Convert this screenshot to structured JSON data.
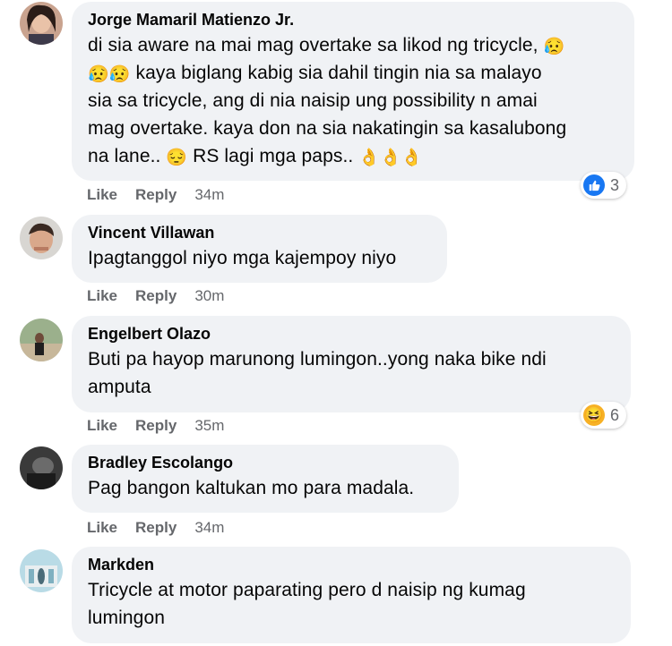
{
  "comments": [
    {
      "author": "Jorge Mamaril Matienzo Jr.",
      "lines": [
        "di sia aware na mai mag overtake sa likod ng tricycle, ",
        " kaya biglang kabig sia dahil tingin nia sa malayo",
        "sia sa tricycle, ang di nia naisip ung possibility n amai",
        "mag overtake. kaya don na sia nakatingin sa kasalubong",
        "na lane.. ",
        " RS lagi mga paps.. "
      ],
      "emoji_crying": "😥",
      "emoji_pensive": "😔",
      "emoji_ok": "👌",
      "like": "Like",
      "reply": "Reply",
      "time": "34m",
      "reaction_count": "3",
      "reaction_icon": "like-icon"
    },
    {
      "author": "Vincent Villawan",
      "text": "Ipagtanggol niyo mga kajempoy niyo",
      "like": "Like",
      "reply": "Reply",
      "time": "30m"
    },
    {
      "author": "Engelbert Olazo",
      "lines": [
        "Buti pa hayop marunong lumingon..yong naka bike ndi",
        "amputa"
      ],
      "like": "Like",
      "reply": "Reply",
      "time": "35m",
      "reaction_count": "6",
      "reaction_icon": "haha-icon",
      "reaction_emoji": "😆"
    },
    {
      "author": "Bradley Escolango",
      "text": "Pag bangon kaltukan mo para madala.",
      "like": "Like",
      "reply": "Reply",
      "time": "34m"
    },
    {
      "author": "Markden",
      "lines": [
        "Tricycle at motor paparating pero d naisip ng kumag",
        "lumingon"
      ]
    }
  ],
  "colors": {
    "bubble": "#f0f2f5",
    "meta": "#65676b",
    "like_blue": "#1877f2",
    "haha_yellow": "#f7b125"
  }
}
